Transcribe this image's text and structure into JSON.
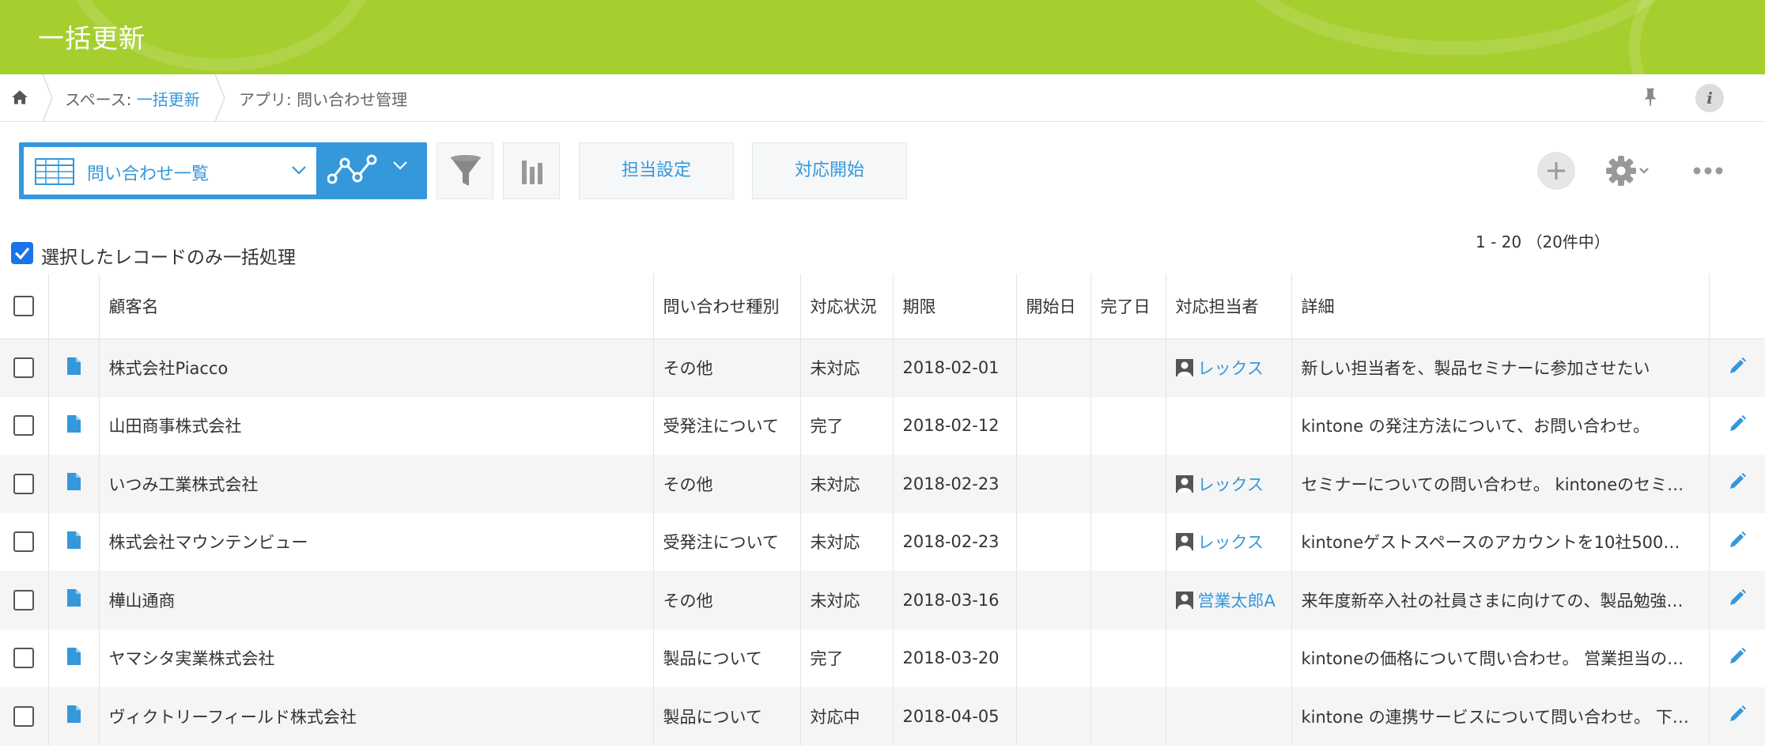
{
  "app": {
    "title": "一括更新"
  },
  "breadcrumb": {
    "space_prefix": "スペース: ",
    "space_name": "一括更新",
    "app_prefix": "アプリ: ",
    "app_name": "問い合わせ管理"
  },
  "toolbar": {
    "view_name": "問い合わせ一覧",
    "assign_label": "担当設定",
    "start_label": "対応開始"
  },
  "batch": {
    "label": "選択したレコードのみ一括処理",
    "checked": true
  },
  "pager": {
    "text": "1 - 20 （20件中）"
  },
  "table": {
    "columns": [
      "顧客名",
      "問い合わせ種別",
      "対応状況",
      "期限",
      "開始日",
      "完了日",
      "対応担当者",
      "詳細"
    ],
    "rows": [
      {
        "customer": "株式会社Piacco",
        "type": "その他",
        "status": "未対応",
        "due": "2018-02-01",
        "start": "",
        "done": "",
        "assignee": "レックス",
        "detail": "新しい担当者を、製品セミナーに参加させたい"
      },
      {
        "customer": "山田商事株式会社",
        "type": "受発注について",
        "status": "完了",
        "due": "2018-02-12",
        "start": "",
        "done": "",
        "assignee": "",
        "detail": "kintone の発注方法について、お問い合わせ。"
      },
      {
        "customer": "いつみ工業株式会社",
        "type": "その他",
        "status": "未対応",
        "due": "2018-02-23",
        "start": "",
        "done": "",
        "assignee": "レックス",
        "detail": "セミナーについての問い合わせ。 kintoneのセミ…"
      },
      {
        "customer": "株式会社マウンテンビュー",
        "type": "受発注について",
        "status": "未対応",
        "due": "2018-02-23",
        "start": "",
        "done": "",
        "assignee": "レックス",
        "detail": "kintoneゲストスペースのアカウントを10社500…"
      },
      {
        "customer": "樺山通商",
        "type": "その他",
        "status": "未対応",
        "due": "2018-03-16",
        "start": "",
        "done": "",
        "assignee": "営業太郎A",
        "detail": "来年度新卒入社の社員さまに向けての、製品勉強…"
      },
      {
        "customer": "ヤマシタ実業株式会社",
        "type": "製品について",
        "status": "完了",
        "due": "2018-03-20",
        "start": "",
        "done": "",
        "assignee": "",
        "detail": "kintoneの価格について問い合わせ。 営業担当の…"
      },
      {
        "customer": "ヴィクトリーフィールド株式会社",
        "type": "製品について",
        "status": "対応中",
        "due": "2018-04-05",
        "start": "",
        "done": "",
        "assignee": "",
        "detail": "kintone の連携サービスについて問い合わせ。 下…"
      }
    ]
  },
  "colors": {
    "header_green": "#a5cf2e",
    "accent_blue": "#3498db"
  }
}
